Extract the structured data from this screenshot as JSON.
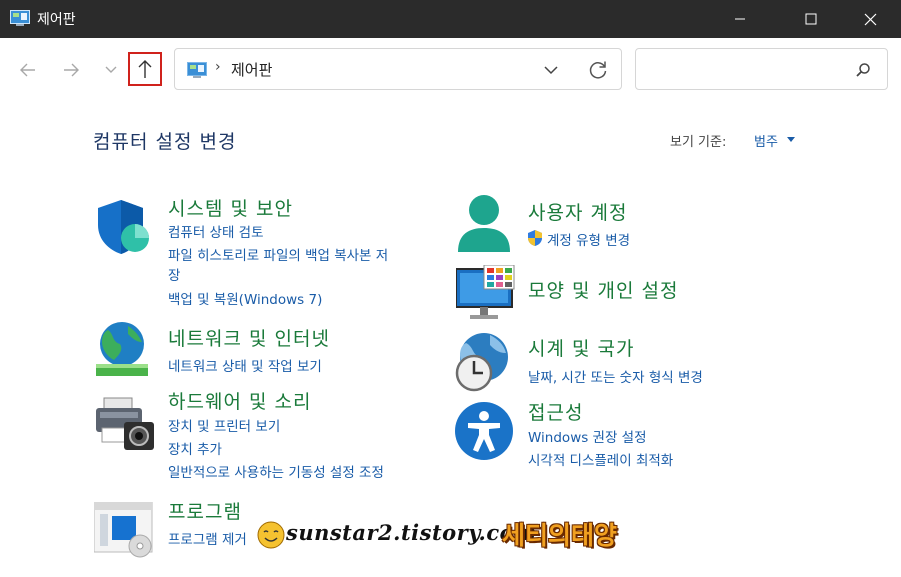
{
  "window": {
    "title": "제어판"
  },
  "address": {
    "separator": "›",
    "path": "제어판"
  },
  "search": {
    "placeholder": ""
  },
  "header": {
    "title": "컴퓨터 설정 변경",
    "view_by_label": "보기 기준:",
    "view_by_value": "범주"
  },
  "categories": {
    "system": {
      "title": "시스템 및 보안",
      "links": [
        "컴퓨터 상태 검토",
        "파일 히스토리로 파일의 백업 복사본 저",
        "장",
        "백업 및 복원(Windows 7)"
      ]
    },
    "network": {
      "title": "네트워크 및 인터넷",
      "links": [
        "네트워크 상태 및 작업 보기"
      ]
    },
    "hardware": {
      "title": "하드웨어 및 소리",
      "links": [
        "장치 및 프린터 보기",
        "장치 추가",
        "일반적으로 사용하는 기동성 설정 조정"
      ]
    },
    "programs": {
      "title": "프로그램",
      "links": [
        "프로그램 제거"
      ]
    },
    "users": {
      "title": "사용자 계정",
      "links": [
        "계정 유형 변경"
      ]
    },
    "appearance": {
      "title": "모양 및 개인 설정",
      "links": []
    },
    "clock": {
      "title": "시계 및 국가",
      "links": [
        "날짜, 시간 또는 숫자 형식 변경"
      ]
    },
    "access": {
      "title": "접근성",
      "links": [
        "Windows 권장 설정",
        "시각적 디스플레이 최적화"
      ]
    }
  },
  "watermark": {
    "text": "sunstar2.tistory.com",
    "brand": "세티의태양"
  },
  "colors": {
    "link": "#1a5ca8",
    "category": "#1a7a3a",
    "title": "#1e3765",
    "highlight": "#d0221c"
  }
}
